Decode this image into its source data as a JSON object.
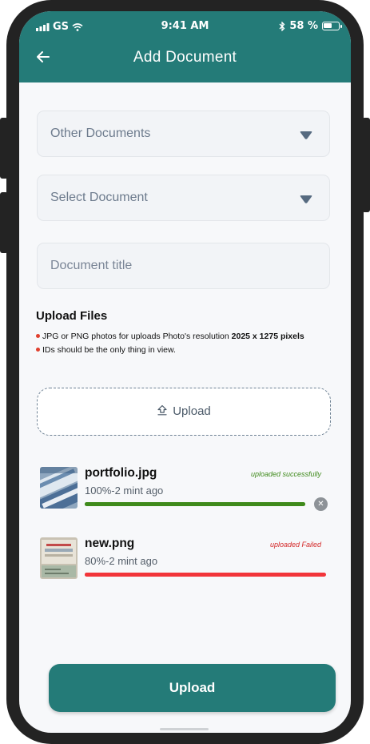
{
  "status_bar": {
    "carrier": "GS",
    "time": "9:41 AM",
    "battery_percent": "58 %",
    "battery_level": 0.58
  },
  "header": {
    "title": "Add Document",
    "back_icon": "arrow-left-icon"
  },
  "form": {
    "category_value": "Other Documents",
    "document_value": "Select Document",
    "title_placeholder": "Document title",
    "dropdown_icon": "caret-down-icon"
  },
  "upload_section": {
    "title": "Upload Files",
    "note_1_text": "JPG or PNG photos for uploads Photo's resolution ",
    "note_1_bold": "2025 x 1275 pixels",
    "note_2": "IDs should be the only thing in view.",
    "upload_label": "Upload",
    "upload_icon": "upload-icon"
  },
  "files": [
    {
      "name": "portfolio.jpg",
      "meta": "100%-2 mint ago",
      "status": "uploaded successfully",
      "status_color": "#3f8a1b",
      "progress": 1.0,
      "bar_color": "#3f8a1b"
    },
    {
      "name": "new.png",
      "meta": "80%-2 mint ago",
      "status": "uploaded Failed",
      "status_color": "#d42828",
      "progress": 0.8,
      "bar_color": "#f2353a"
    }
  ],
  "remove_icon": "close-icon",
  "submit_label": "Upload",
  "colors": {
    "brand": "#247b78",
    "success": "#3f8a1b",
    "error": "#f2353a"
  }
}
